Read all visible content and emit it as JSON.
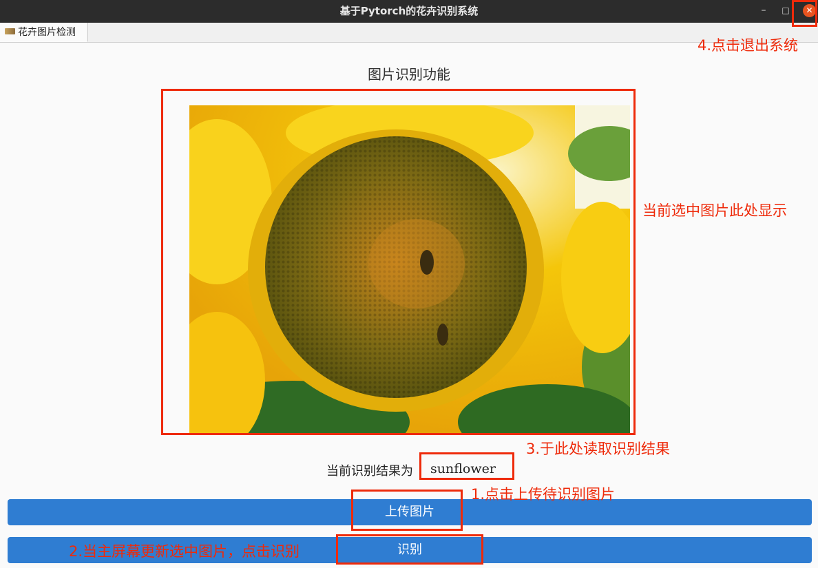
{
  "window": {
    "title": "基于Pytorch的花卉识别系统",
    "minimize": "–",
    "maximize": "□",
    "close": "✕"
  },
  "tab": {
    "label": "花卉图片检测",
    "icon": "image-icon"
  },
  "main": {
    "section_title": "图片识别功能",
    "result_label": "当前识别结果为",
    "result_value": "sunflower",
    "upload_button": "上传图片",
    "recognize_button": "识别"
  },
  "annotations": {
    "exit": "4.点击退出系统",
    "display": "当前选中图片此处显示",
    "read_result": "3.于此处读取识别结果",
    "upload": "1.点击上传待识别图片",
    "recognize": "2.当主屏幕更新选中图片，点击识别"
  },
  "colors": {
    "annotation_red": "#ee2a0a",
    "button_blue": "#2f7dd2",
    "titlebar": "#2c2c2c",
    "close_orange": "#e95420"
  }
}
